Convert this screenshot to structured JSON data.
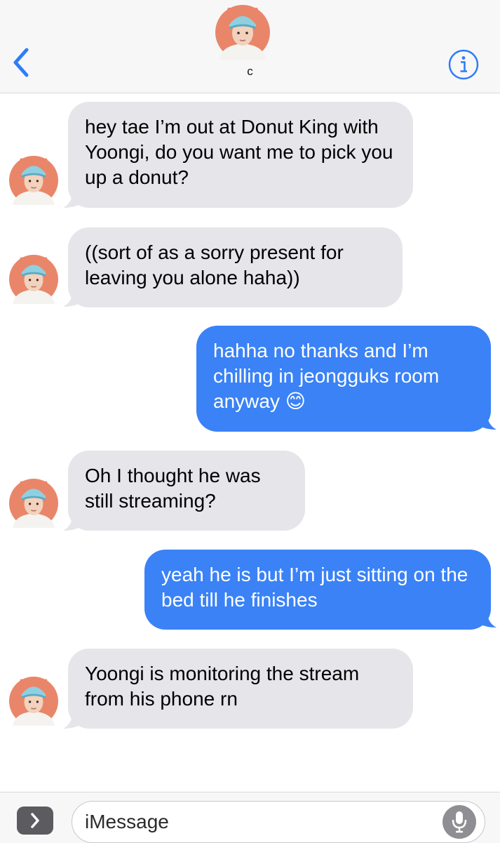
{
  "header": {
    "contact_name": "c",
    "back_icon": "chevron-left-icon",
    "info_icon": "info-icon"
  },
  "messages": [
    {
      "direction": "incoming",
      "text": "hey tae I’m out at Donut King with Yoongi, do you want me to pick you up a donut?"
    },
    {
      "direction": "incoming",
      "text": "((sort of as a sorry present for leaving you alone haha))"
    },
    {
      "direction": "outgoing",
      "text": "hahha no thanks and I’m chilling in jeongguks room anyway 😊"
    },
    {
      "direction": "incoming",
      "text": "Oh I thought he was still streaming?"
    },
    {
      "direction": "outgoing",
      "text": "yeah he is but I’m just sitting on the bed till he finishes"
    },
    {
      "direction": "incoming",
      "text": "Yoongi is monitoring the stream from his phone rn"
    }
  ],
  "input_bar": {
    "placeholder": "iMessage",
    "apps_icon": "chevron-right-icon",
    "mic_icon": "microphone-icon"
  },
  "colors": {
    "accent": "#2f7cf6",
    "incoming_bubble": "#e5e5ea",
    "outgoing_bubble": "#3a82f6"
  }
}
